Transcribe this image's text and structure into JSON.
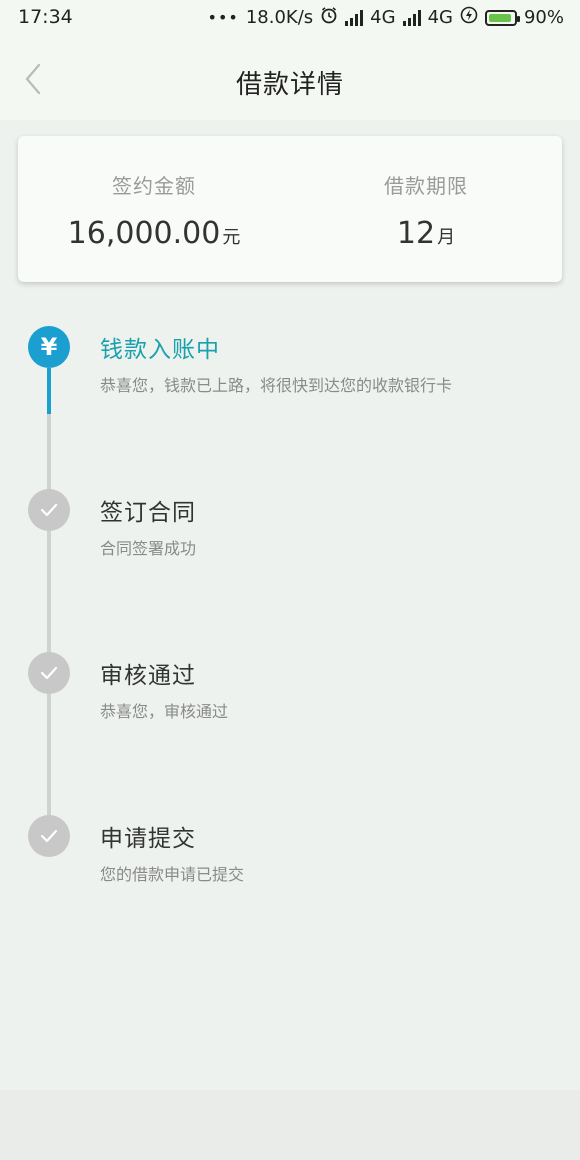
{
  "status_bar": {
    "time": "17:34",
    "dots": "•••",
    "net_speed": "18.0K/s",
    "network1": "4G",
    "network2": "4G",
    "battery_percent": "90%",
    "icons": [
      "alarm-icon",
      "hd-icon",
      "signal-icon",
      "charging-icon",
      "battery-icon"
    ]
  },
  "header": {
    "title": "借款详情",
    "back_icon": "chevron-left-icon"
  },
  "summary": {
    "amount_label": "签约金额",
    "amount_value": "16,000.00",
    "amount_unit": "元",
    "term_label": "借款期限",
    "term_value": "12",
    "term_unit": "月"
  },
  "timeline": {
    "accent_color": "#1a9fd0",
    "steps": [
      {
        "title": "钱款入账中",
        "desc": "恭喜您，钱款已上路，将很快到达您的收款银行卡",
        "icon": "yen-icon",
        "status": "current"
      },
      {
        "title": "签订合同",
        "desc": "合同签署成功",
        "icon": "check-icon",
        "status": "done"
      },
      {
        "title": "审核通过",
        "desc": "恭喜您，审核通过",
        "icon": "check-icon",
        "status": "done"
      },
      {
        "title": "申请提交",
        "desc": "您的借款申请已提交",
        "icon": "check-icon",
        "status": "done"
      }
    ]
  }
}
